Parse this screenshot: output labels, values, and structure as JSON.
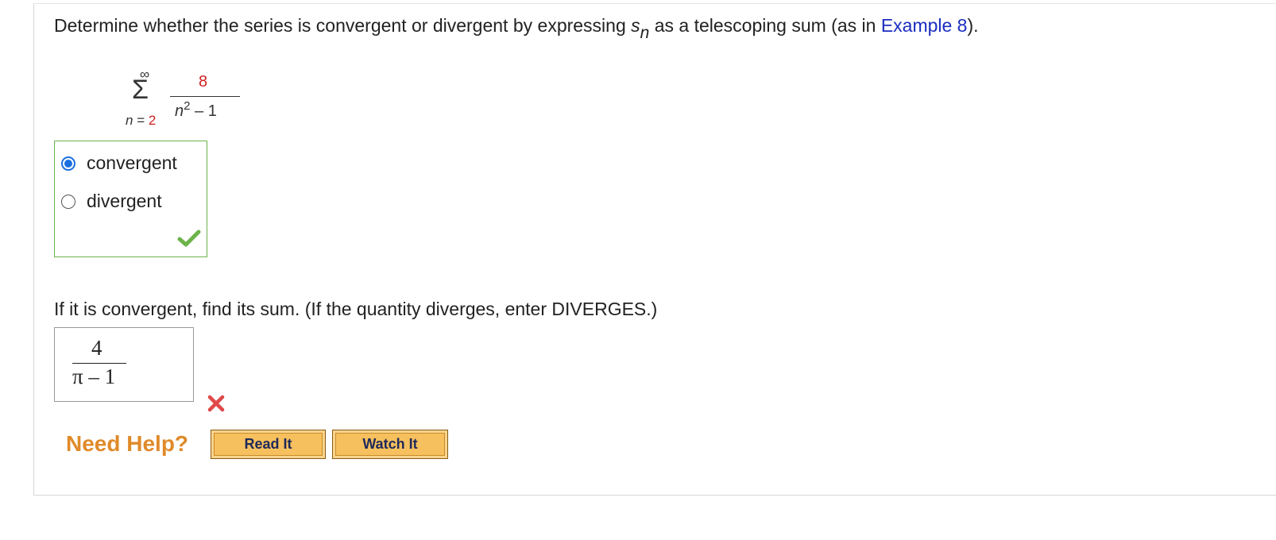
{
  "question": {
    "prefix": "Determine whether the series is convergent or divergent by expressing ",
    "s_var": "s",
    "s_sub": "n",
    "middle": " as a telescoping sum (as in ",
    "link": "Example 8",
    "suffix": ")."
  },
  "series": {
    "upper_limit": "∞",
    "sigma": "Σ",
    "lower_var": "n",
    "lower_eq": " = ",
    "lower_value": "2",
    "numerator": "8",
    "den_var": "n",
    "den_exp": "2",
    "den_rest": " – 1"
  },
  "choices": {
    "options": [
      {
        "label": "convergent",
        "selected": true
      },
      {
        "label": "divergent",
        "selected": false
      }
    ],
    "result": "correct"
  },
  "question2": {
    "text": "If it is convergent, find its sum. (If the quantity diverges, enter DIVERGES.)"
  },
  "answer": {
    "numerator": "4",
    "denominator": "π – 1",
    "result": "incorrect"
  },
  "help": {
    "label": "Need Help?",
    "read_label": "Read It",
    "watch_label": "Watch It"
  },
  "colors": {
    "link": "#1a2dbf",
    "correct": "#6cb34a",
    "incorrect": "#e04848",
    "help": "#e08a2a",
    "button": "#f7c05e"
  }
}
